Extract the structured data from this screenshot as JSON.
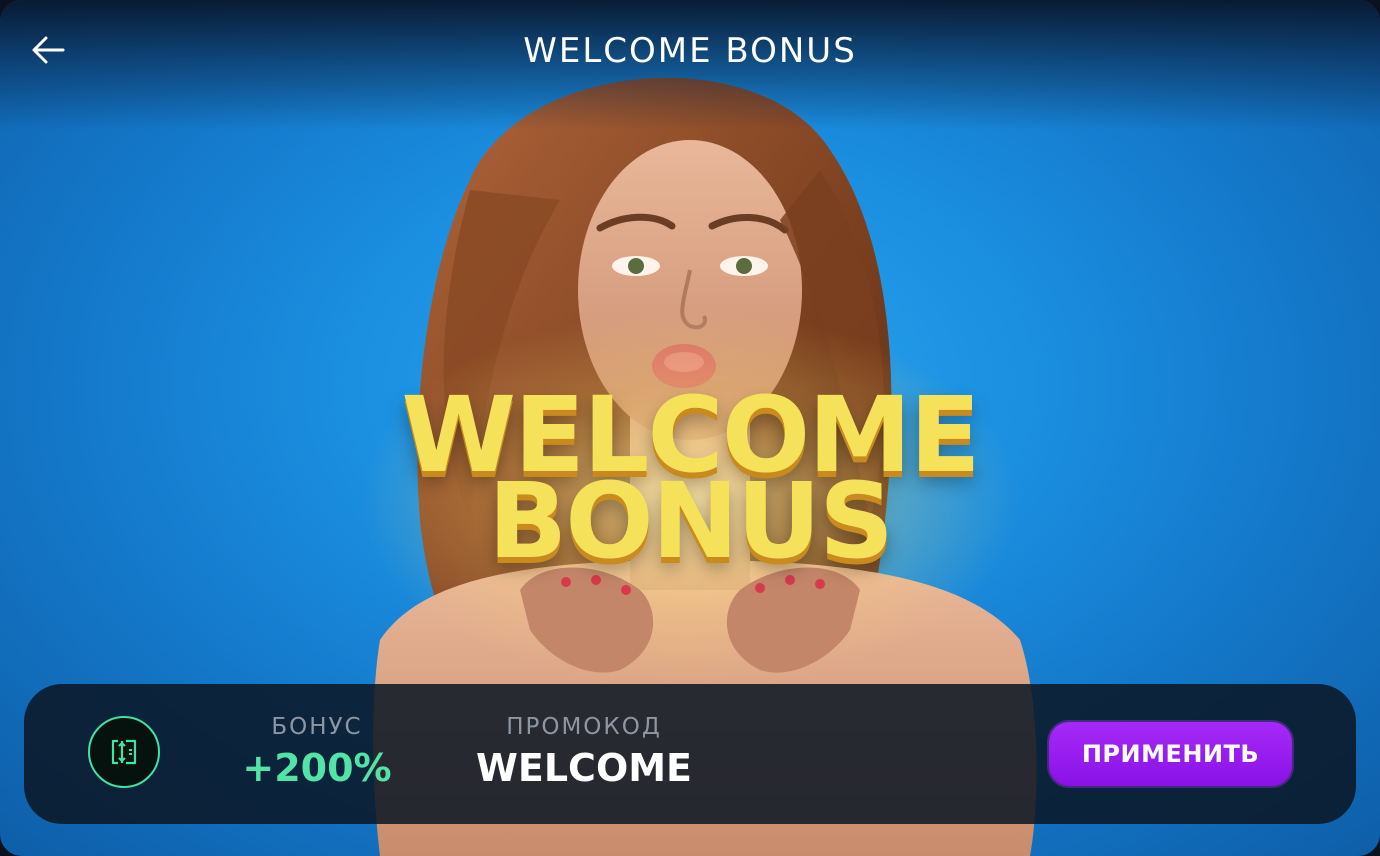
{
  "header": {
    "title": "WELCOME BONUS",
    "back_icon": "arrow-left-icon"
  },
  "hero": {
    "line1": "WELCOME",
    "line2": "BONUS",
    "text_color": "#f6e25a",
    "background_color": "#1b8fe0"
  },
  "promo": {
    "icon": "promo-code-icon",
    "bonus_label": "БОНУС",
    "bonus_value": "+200%",
    "code_label": "ПРОМОКОД",
    "code_value": "WELCOME",
    "apply_label": "ПРИМЕНИТЬ",
    "accent_green": "#52e3a6",
    "accent_purple": "#9a1ef0"
  }
}
